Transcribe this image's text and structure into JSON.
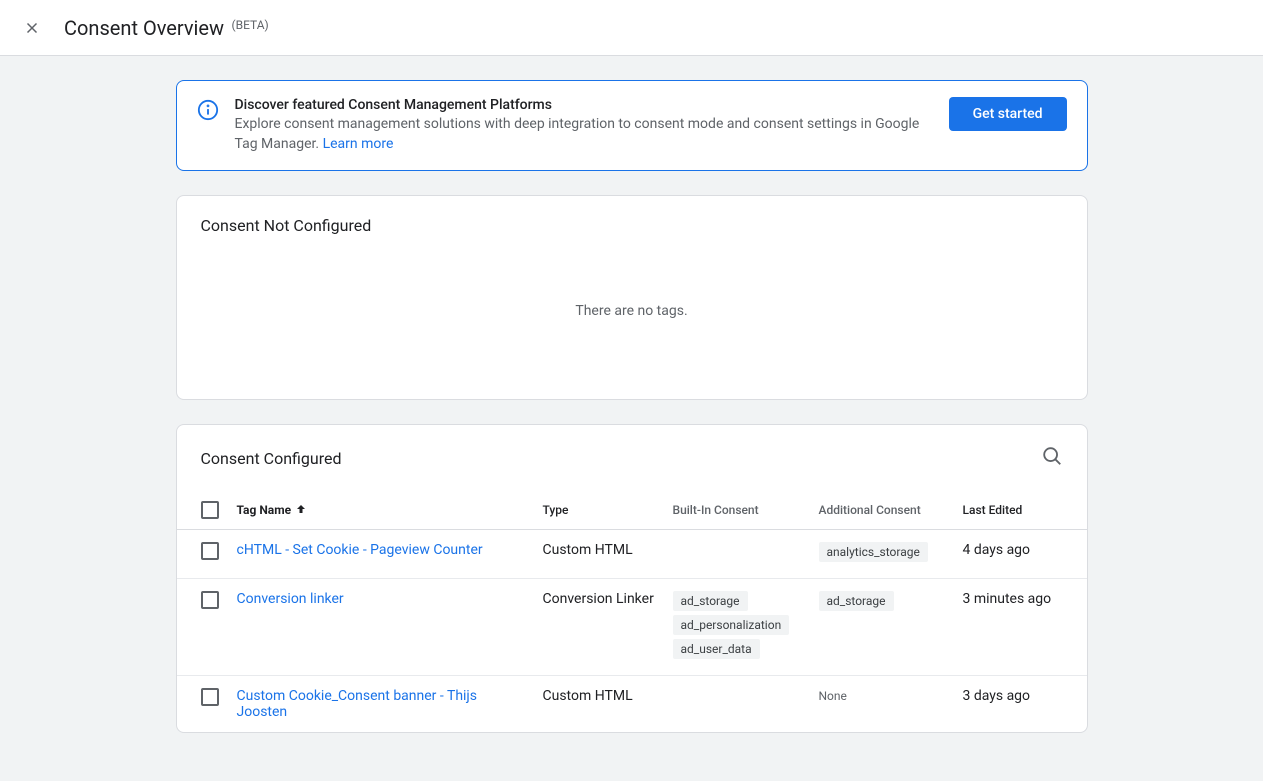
{
  "header": {
    "title": "Consent Overview",
    "badge": "(BETA)"
  },
  "banner": {
    "title": "Discover featured Consent Management Platforms",
    "description": "Explore consent management solutions with deep integration to consent mode and consent settings in Google Tag Manager. ",
    "learn_more": "Learn more",
    "button": "Get started"
  },
  "section_not_configured": {
    "title": "Consent Not Configured",
    "empty": "There are no tags."
  },
  "section_configured": {
    "title": "Consent Configured",
    "columns": {
      "name": "Tag Name",
      "type": "Type",
      "builtin": "Built-In Consent",
      "additional": "Additional Consent",
      "edited": "Last Edited"
    },
    "rows": [
      {
        "name": "cHTML - Set Cookie - Pageview Counter",
        "type": "Custom HTML",
        "builtin": [],
        "additional": [
          "analytics_storage"
        ],
        "additional_none": "",
        "edited": "4 days ago"
      },
      {
        "name": "Conversion linker",
        "type": "Conversion Linker",
        "builtin": [
          "ad_storage",
          "ad_personalization",
          "ad_user_data"
        ],
        "additional": [
          "ad_storage"
        ],
        "additional_none": "",
        "edited": "3 minutes ago"
      },
      {
        "name": "Custom Cookie_Consent banner - Thijs Joosten",
        "type": "Custom HTML",
        "builtin": [],
        "additional": [],
        "additional_none": "None",
        "edited": "3 days ago"
      }
    ]
  }
}
